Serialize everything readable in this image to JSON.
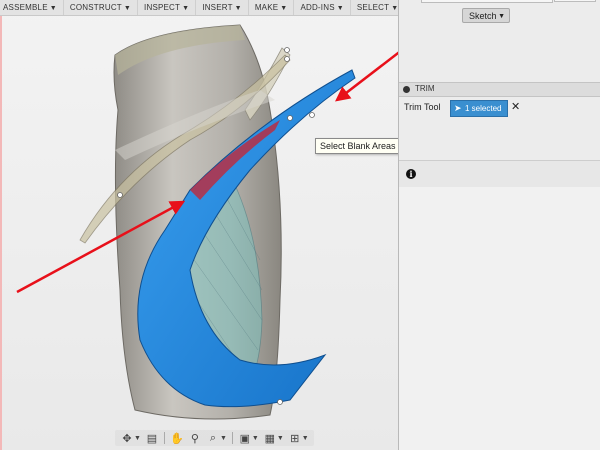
{
  "toolbar": {
    "items": [
      {
        "label": "ASSEMBLE",
        "caret": "▼"
      },
      {
        "label": "CONSTRUCT",
        "caret": "▼"
      },
      {
        "label": "INSPECT",
        "caret": "▼"
      },
      {
        "label": "INSERT",
        "caret": "▼"
      },
      {
        "label": "MAKE",
        "caret": "▼"
      },
      {
        "label": "ADD-INS",
        "caret": "▼"
      },
      {
        "label": "SELECT",
        "caret": "▼"
      }
    ]
  },
  "viewport": {
    "tooltip": "Select Blank Areas to remove",
    "annotation_arrow_color": "#e8101a",
    "surface_color": "#1a8ae0"
  },
  "nav_bar": {
    "icons": [
      "orbit-icon",
      "look-at-icon",
      "pan-icon",
      "zoom-icon",
      "zoom-window-icon",
      "display-icon",
      "grid-icon",
      "view-cube-icon"
    ]
  },
  "right_panel": {
    "sketch_dropdown": {
      "label": "Sketch",
      "caret": "▼"
    },
    "trim": {
      "title": "TRIM",
      "tool_label": "Trim Tool",
      "selected_label": "1 selected",
      "clear_glyph": "✕",
      "selected_color": "#3a8fd0"
    },
    "info_glyph": "i"
  }
}
